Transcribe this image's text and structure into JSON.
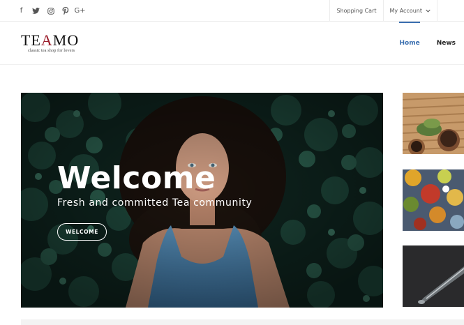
{
  "social": {
    "icons": [
      "facebook-icon",
      "twitter-icon",
      "instagram-icon",
      "pinterest-icon",
      "google-plus-icon"
    ],
    "glyphs": [
      "f",
      "🐦",
      "◎",
      "℗",
      "G+"
    ]
  },
  "utility": {
    "shopping_cart": "Shopping Cart",
    "my_account": "My Account",
    "chevron": "⌄"
  },
  "logo": {
    "brand_start": "TE",
    "brand_accent": "A",
    "brand_end": "MO",
    "tagline": "classic tea shop for lovers"
  },
  "nav": {
    "items": [
      "Home",
      "News"
    ],
    "active": "Home"
  },
  "hero": {
    "title": "Welcome",
    "subtitle": "Fresh and committed Tea community",
    "button": "WELCOME"
  },
  "colors": {
    "accent": "#3a6fb0",
    "brand_red": "#9b1c2a"
  }
}
